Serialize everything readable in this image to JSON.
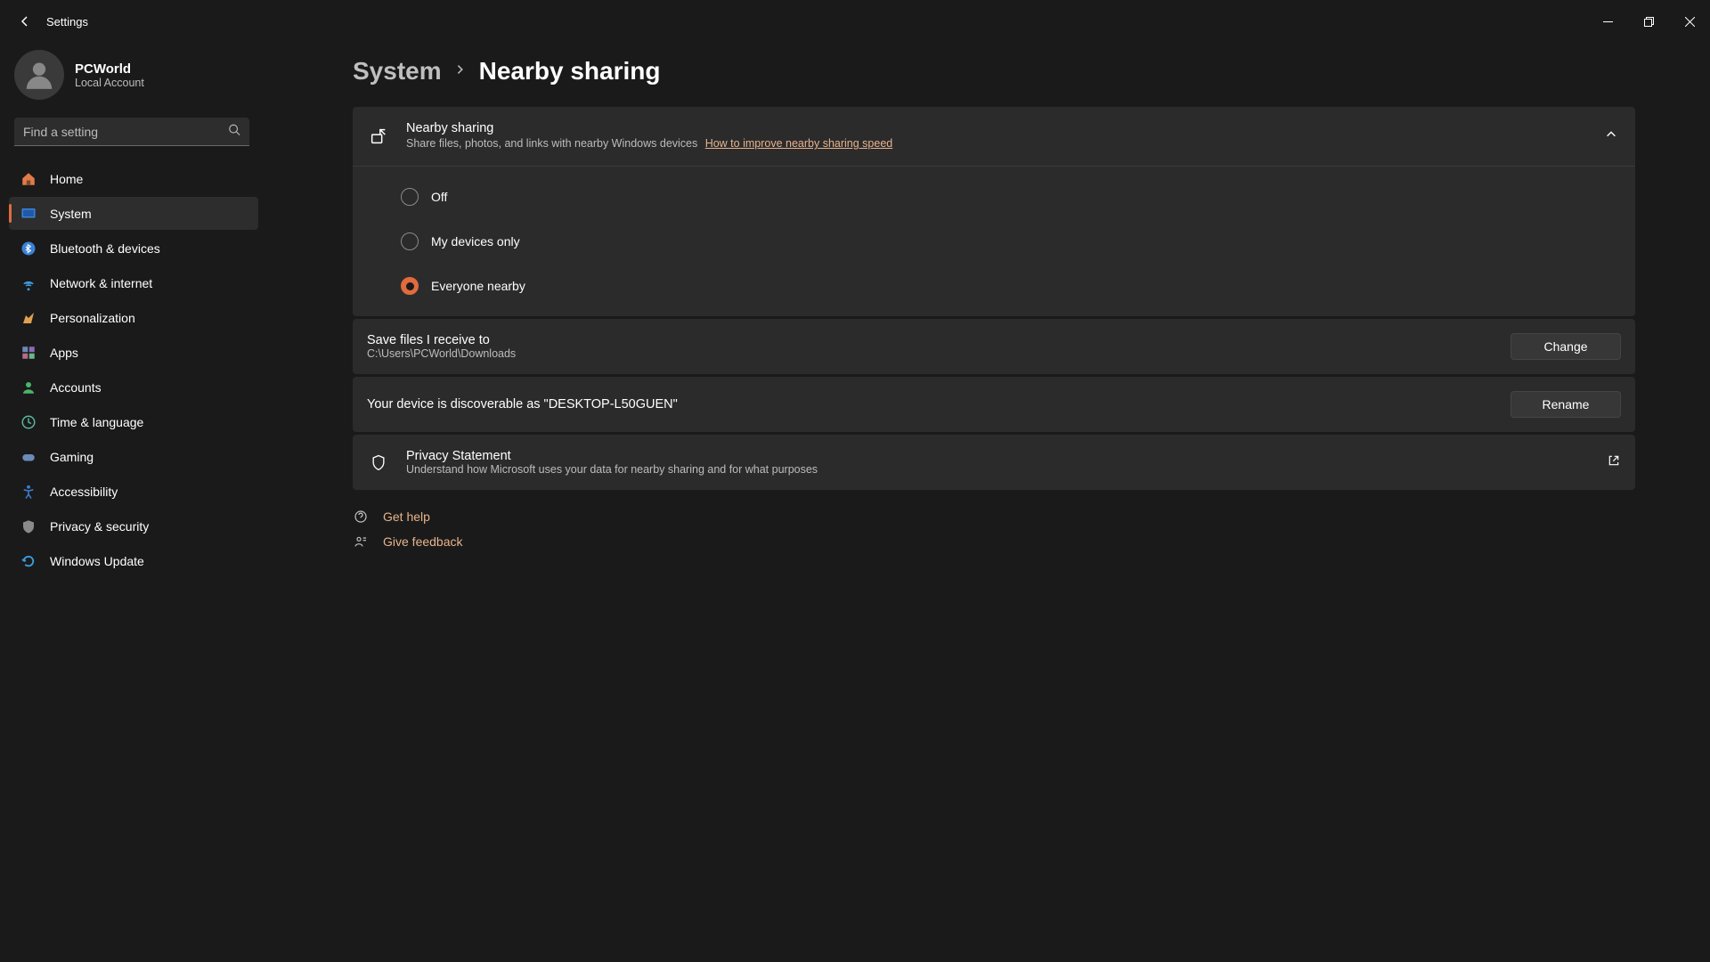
{
  "app": {
    "title": "Settings"
  },
  "account": {
    "name": "PCWorld",
    "type": "Local Account"
  },
  "search": {
    "placeholder": "Find a setting"
  },
  "sidebar": {
    "items": [
      {
        "label": "Home"
      },
      {
        "label": "System"
      },
      {
        "label": "Bluetooth & devices"
      },
      {
        "label": "Network & internet"
      },
      {
        "label": "Personalization"
      },
      {
        "label": "Apps"
      },
      {
        "label": "Accounts"
      },
      {
        "label": "Time & language"
      },
      {
        "label": "Gaming"
      },
      {
        "label": "Accessibility"
      },
      {
        "label": "Privacy & security"
      },
      {
        "label": "Windows Update"
      }
    ]
  },
  "breadcrumb": {
    "parent": "System",
    "current": "Nearby sharing"
  },
  "nearby": {
    "title": "Nearby sharing",
    "subtitle": "Share files, photos, and links with nearby Windows devices",
    "helpLink": "How to improve nearby sharing speed",
    "options": [
      {
        "label": "Off"
      },
      {
        "label": "My devices only"
      },
      {
        "label": "Everyone nearby"
      }
    ]
  },
  "savePath": {
    "title": "Save files I receive to",
    "value": "C:\\Users\\PCWorld\\Downloads",
    "button": "Change"
  },
  "discoverable": {
    "title": "Your device is discoverable as \"DESKTOP-L50GUEN\"",
    "button": "Rename"
  },
  "privacy": {
    "title": "Privacy Statement",
    "sub": "Understand how Microsoft uses your data for nearby sharing and for what purposes"
  },
  "links": {
    "help": "Get help",
    "feedback": "Give feedback"
  }
}
